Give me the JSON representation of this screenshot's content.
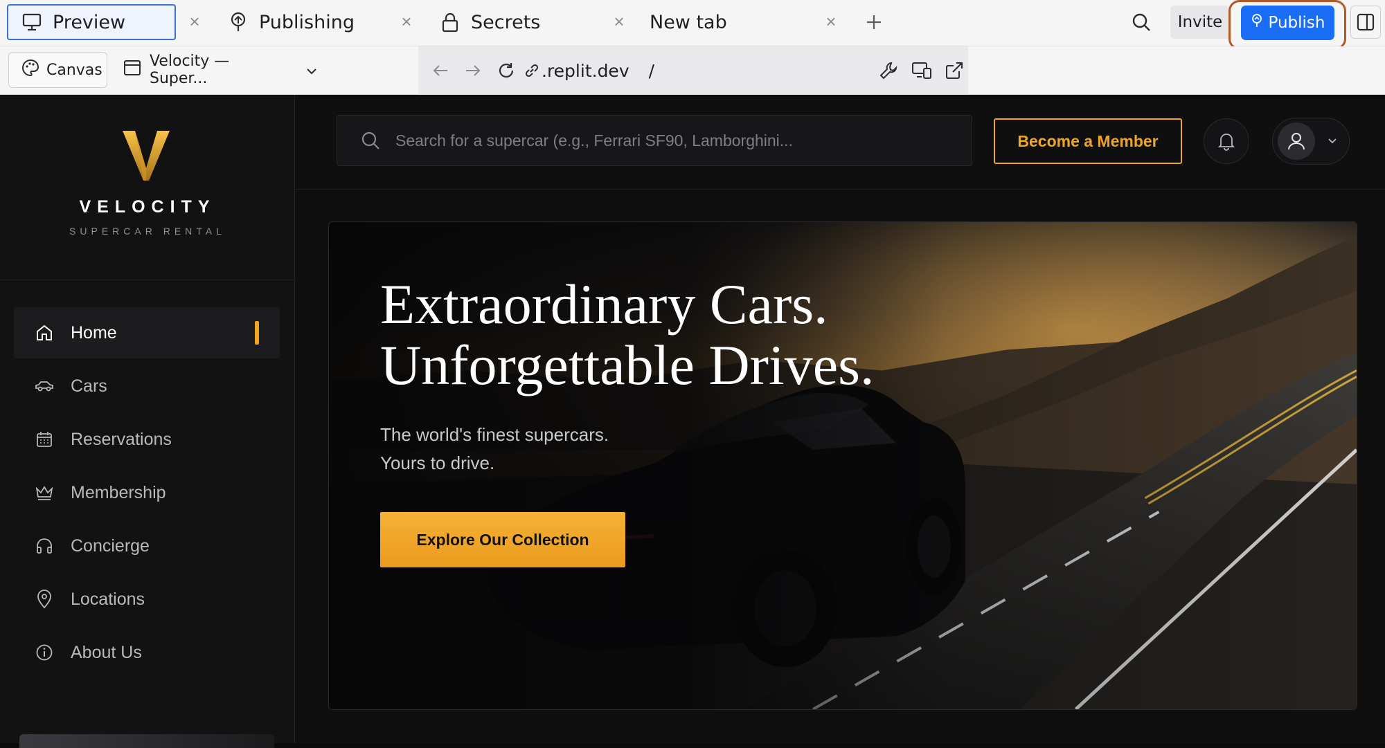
{
  "browser": {
    "tabs": [
      {
        "label": "Preview",
        "icon": "monitor-icon",
        "active": true
      },
      {
        "label": "Publishing",
        "icon": "publish-icon",
        "active": false
      },
      {
        "label": "Secrets",
        "icon": "lock-icon",
        "active": false
      },
      {
        "label": "New tab",
        "icon": "",
        "active": false
      }
    ],
    "invite_label": "Invite",
    "publish_label": "Publish",
    "canvas_label": "Canvas",
    "page_selector": "Velocity — Super...",
    "url": ".replit.dev",
    "path": "/"
  },
  "brand": {
    "name": "VELOCITY",
    "tagline": "SUPERCAR RENTAL",
    "accent": "#f0a624"
  },
  "sidebar": {
    "items": [
      {
        "label": "Home",
        "icon": "home-icon",
        "active": true
      },
      {
        "label": "Cars",
        "icon": "car-icon",
        "active": false
      },
      {
        "label": "Reservations",
        "icon": "calendar-icon",
        "active": false
      },
      {
        "label": "Membership",
        "icon": "crown-icon",
        "active": false
      },
      {
        "label": "Concierge",
        "icon": "headphones-icon",
        "active": false
      },
      {
        "label": "Locations",
        "icon": "map-pin-icon",
        "active": false
      },
      {
        "label": "About Us",
        "icon": "info-icon",
        "active": false
      }
    ]
  },
  "header": {
    "search_placeholder": "Search for a supercar (e.g., Ferrari SF90, Lamborghini...",
    "member_button": "Become a Member"
  },
  "hero": {
    "title_line1": "Extraordinary Cars.",
    "title_line2": "Unforgettable Drives.",
    "subtitle_line1": "The world's finest supercars.",
    "subtitle_line2": "Yours to drive.",
    "cta_label": "Explore Our Collection"
  }
}
